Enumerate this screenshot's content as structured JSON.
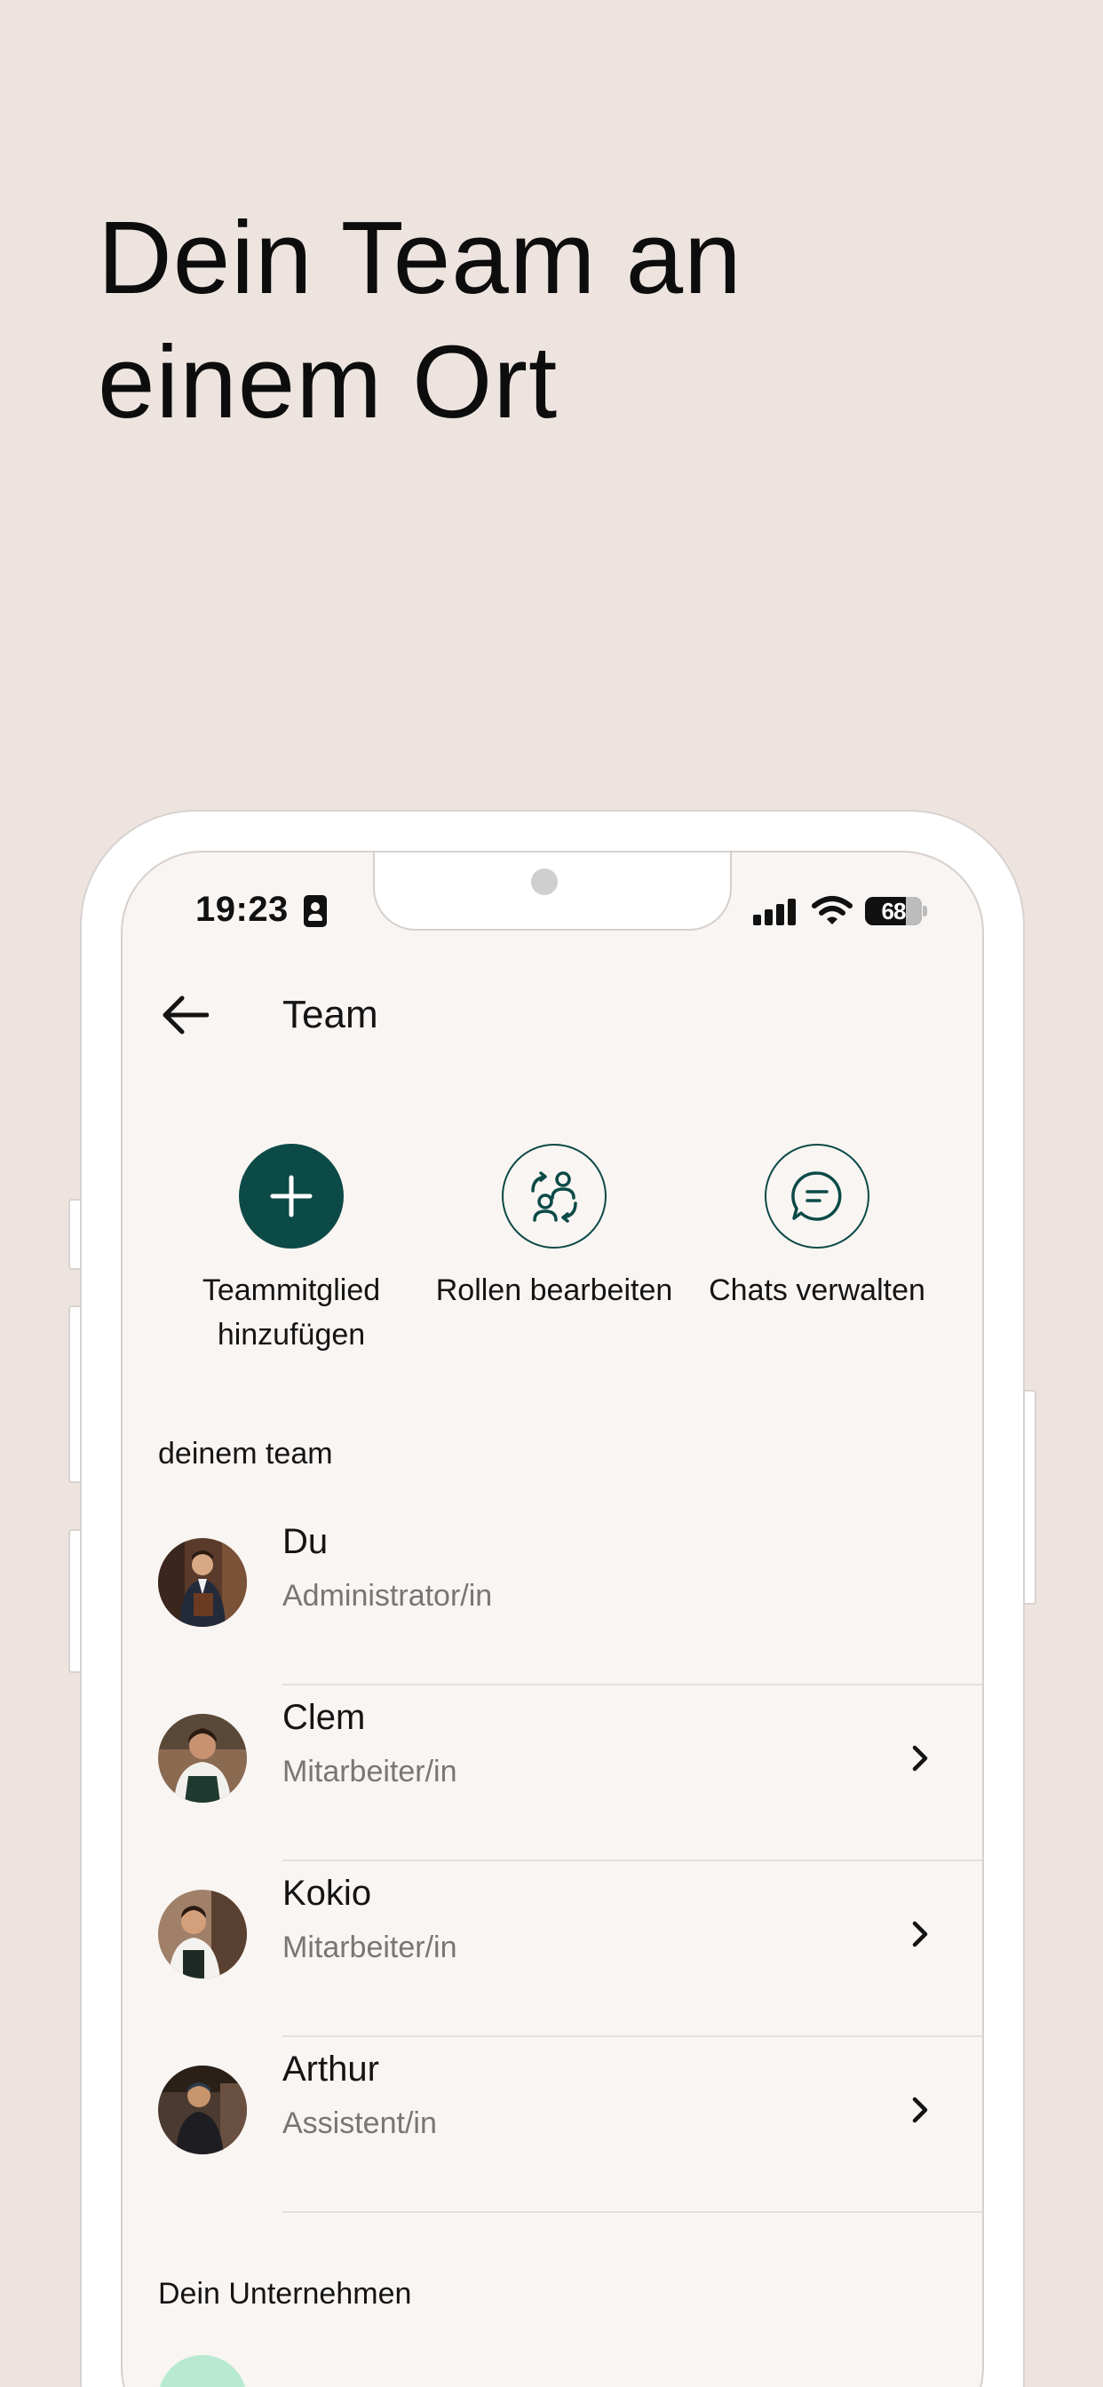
{
  "headline": "Dein Team an einem Ort",
  "status_bar": {
    "time": "19:23",
    "battery": "68"
  },
  "header": {
    "title": "Team"
  },
  "actions": [
    {
      "label": "Teammitglied hinzufügen",
      "icon": "plus-icon"
    },
    {
      "label": "Rollen bearbeiten",
      "icon": "swap-roles-icon"
    },
    {
      "label": "Chats verwalten",
      "icon": "chat-icon"
    }
  ],
  "team_section": {
    "title": "deinem team",
    "members": [
      {
        "name": "Du",
        "role": "Administrator/in",
        "has_chevron": false
      },
      {
        "name": "Clem",
        "role": "Mitarbeiter/in",
        "has_chevron": true
      },
      {
        "name": "Kokio",
        "role": "Mitarbeiter/in",
        "has_chevron": true
      },
      {
        "name": "Arthur",
        "role": "Assistent/in",
        "has_chevron": true
      }
    ]
  },
  "company_section": {
    "title": "Dein Unternehmen"
  },
  "colors": {
    "background": "#EEE4DF",
    "screen": "#F9F5F3",
    "accent": "#0C4A47",
    "company_avatar": "#B8EAD2"
  }
}
